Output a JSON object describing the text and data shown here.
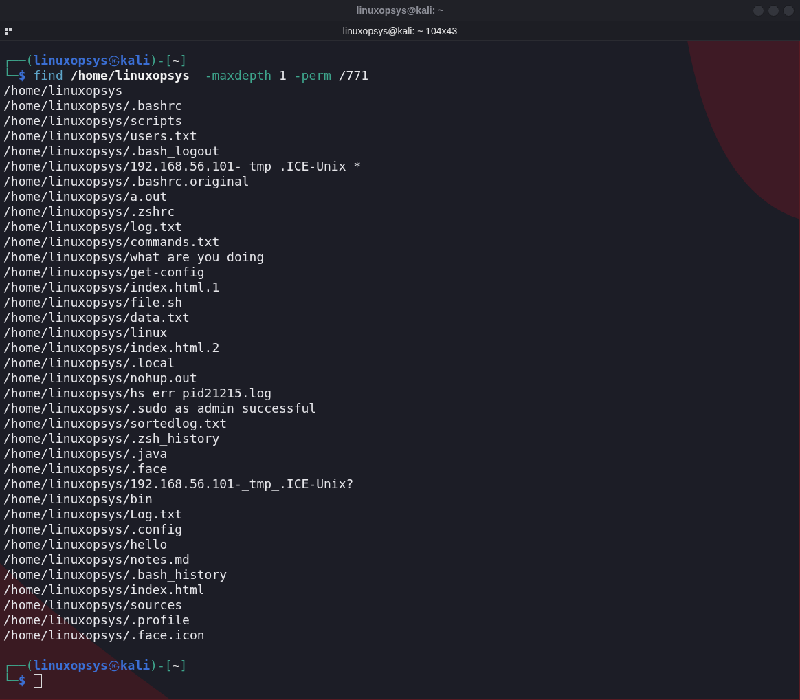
{
  "window": {
    "title": "linuxopsys@kali: ~"
  },
  "tab": {
    "title": "linuxopsys@kali: ~ 104x43"
  },
  "prompts": [
    {
      "top": "┌──",
      "open": "(",
      "user": "linuxopsys",
      "at": "㉿",
      "host": "kali",
      "close": ")",
      "sep": "-",
      "dir_open": "[",
      "dir": "~",
      "dir_close": "]",
      "bottom": "└─",
      "symbol": "$",
      "command": [
        {
          "kind": "cmd",
          "text": "find"
        },
        {
          "kind": "path",
          "text": "/home/linuxopsys"
        },
        {
          "kind": "flag",
          "text": " -maxdepth"
        },
        {
          "kind": "arg",
          "text": "1"
        },
        {
          "kind": "flag",
          "text": "-perm"
        },
        {
          "kind": "arg",
          "text": "/771"
        }
      ],
      "output": [
        "/home/linuxopsys",
        "/home/linuxopsys/.bashrc",
        "/home/linuxopsys/scripts",
        "/home/linuxopsys/users.txt",
        "/home/linuxopsys/.bash_logout",
        "/home/linuxopsys/192.168.56.101-_tmp_.ICE-Unix_*",
        "/home/linuxopsys/.bashrc.original",
        "/home/linuxopsys/a.out",
        "/home/linuxopsys/.zshrc",
        "/home/linuxopsys/log.txt",
        "/home/linuxopsys/commands.txt",
        "/home/linuxopsys/what are you doing",
        "/home/linuxopsys/get-config",
        "/home/linuxopsys/index.html.1",
        "/home/linuxopsys/file.sh",
        "/home/linuxopsys/data.txt",
        "/home/linuxopsys/linux",
        "/home/linuxopsys/index.html.2",
        "/home/linuxopsys/.local",
        "/home/linuxopsys/nohup.out",
        "/home/linuxopsys/hs_err_pid21215.log",
        "/home/linuxopsys/.sudo_as_admin_successful",
        "/home/linuxopsys/sortedlog.txt",
        "/home/linuxopsys/.zsh_history",
        "/home/linuxopsys/.java",
        "/home/linuxopsys/.face",
        "/home/linuxopsys/192.168.56.101-_tmp_.ICE-Unix?",
        "/home/linuxopsys/bin",
        "/home/linuxopsys/Log.txt",
        "/home/linuxopsys/.config",
        "/home/linuxopsys/hello",
        "/home/linuxopsys/notes.md",
        "/home/linuxopsys/.bash_history",
        "/home/linuxopsys/index.html",
        "/home/linuxopsys/sources",
        "/home/linuxopsys/.profile",
        "/home/linuxopsys/.face.icon"
      ]
    },
    {
      "top": "┌──",
      "open": "(",
      "user": "linuxopsys",
      "at": "㉿",
      "host": "kali",
      "close": ")",
      "sep": "-",
      "dir_open": "[",
      "dir": "~",
      "dir_close": "]",
      "bottom": "└─",
      "symbol": "$",
      "cursor": true
    }
  ]
}
